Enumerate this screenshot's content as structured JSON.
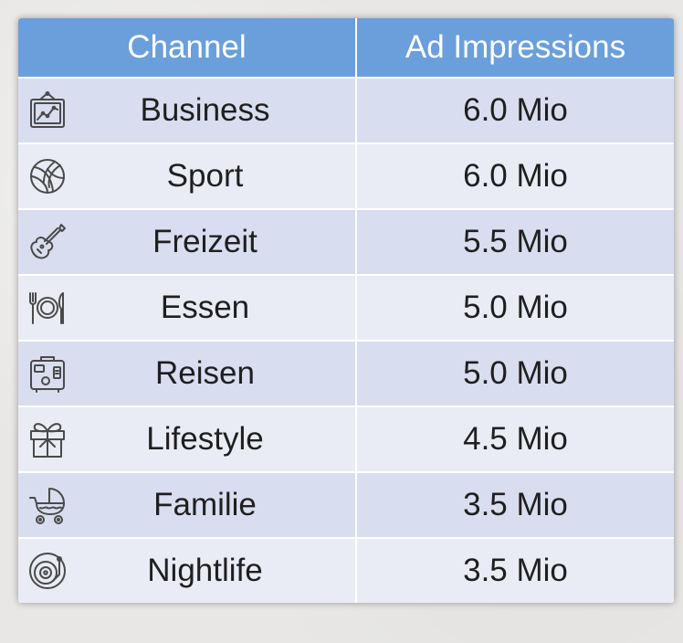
{
  "chart_data": {
    "type": "table",
    "columns": [
      "Channel",
      "Ad Impressions"
    ],
    "rows": [
      {
        "channel": "Business",
        "icon": "chart-board-icon",
        "value": 6.0,
        "display": "6.0 Mio"
      },
      {
        "channel": "Sport",
        "icon": "volleyball-icon",
        "value": 6.0,
        "display": "6.0 Mio"
      },
      {
        "channel": "Freizeit",
        "icon": "guitar-icon",
        "value": 5.5,
        "display": "5.5 Mio"
      },
      {
        "channel": "Essen",
        "icon": "plate-cutlery-icon",
        "value": 5.0,
        "display": "5.0 Mio"
      },
      {
        "channel": "Reisen",
        "icon": "suitcase-icon",
        "value": 5.0,
        "display": "5.0 Mio"
      },
      {
        "channel": "Lifestyle",
        "icon": "gift-icon",
        "value": 4.5,
        "display": "4.5 Mio"
      },
      {
        "channel": "Familie",
        "icon": "baby-stroller-icon",
        "value": 3.5,
        "display": "3.5 Mio"
      },
      {
        "channel": "Nightlife",
        "icon": "turntable-icon",
        "value": 3.5,
        "display": "3.5 Mio"
      }
    ]
  },
  "colors": {
    "header_bg": "#6a9fdc",
    "row_odd_bg": "#d8deef",
    "row_even_bg": "#e9ecf5",
    "icon_stroke": "#4a4a4a"
  }
}
